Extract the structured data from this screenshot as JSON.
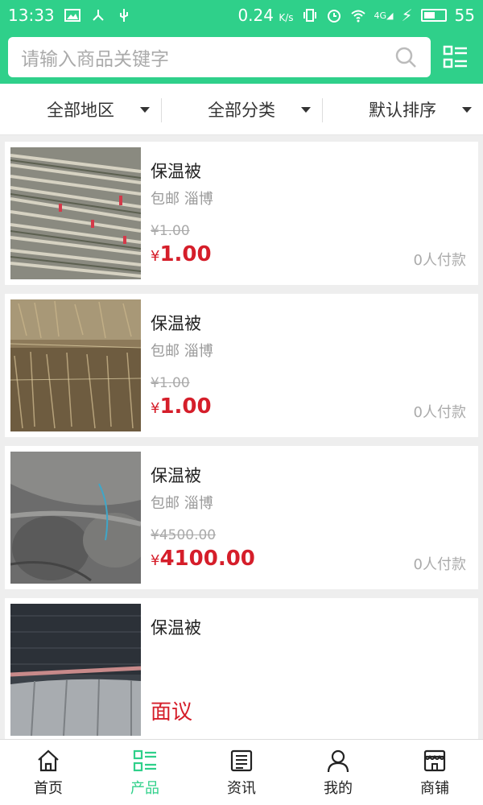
{
  "status_bar": {
    "time": "13:33",
    "speed": "0.24",
    "speed_unit": "K/s",
    "network": "4G",
    "battery": "55",
    "battery_level": 0.55
  },
  "search": {
    "placeholder": "请输入商品关键字"
  },
  "filters": [
    {
      "label": "全部地区"
    },
    {
      "label": "全部分类"
    },
    {
      "label": "默认排序"
    }
  ],
  "products": [
    {
      "name": "保温被",
      "shipping": "包邮",
      "location": "淄博",
      "old_price": "¥1.00",
      "currency": "¥",
      "price": "1.00",
      "paid": "0人付款",
      "image": "bamboo-poles"
    },
    {
      "name": "保温被",
      "shipping": "包邮",
      "location": "淄博",
      "old_price": "¥1.00",
      "currency": "¥",
      "price": "1.00",
      "paid": "0人付款",
      "image": "straw-mat"
    },
    {
      "name": "保温被",
      "shipping": "包邮",
      "location": "淄博",
      "old_price": "¥4500.00",
      "currency": "¥",
      "price": "4100.00",
      "paid": "0人付款",
      "image": "felt-rolls"
    },
    {
      "name": "保温被",
      "negotiable": "面议",
      "image": "greenhouse-cover"
    }
  ],
  "nav": [
    {
      "label": "首页",
      "icon": "home-icon"
    },
    {
      "label": "产品",
      "icon": "list-icon",
      "active": true
    },
    {
      "label": "资讯",
      "icon": "news-icon"
    },
    {
      "label": "我的",
      "icon": "user-icon"
    },
    {
      "label": "商铺",
      "icon": "store-icon"
    }
  ],
  "colors": {
    "accent": "#2fd08a",
    "price": "#d51e2a",
    "muted": "#999999"
  }
}
